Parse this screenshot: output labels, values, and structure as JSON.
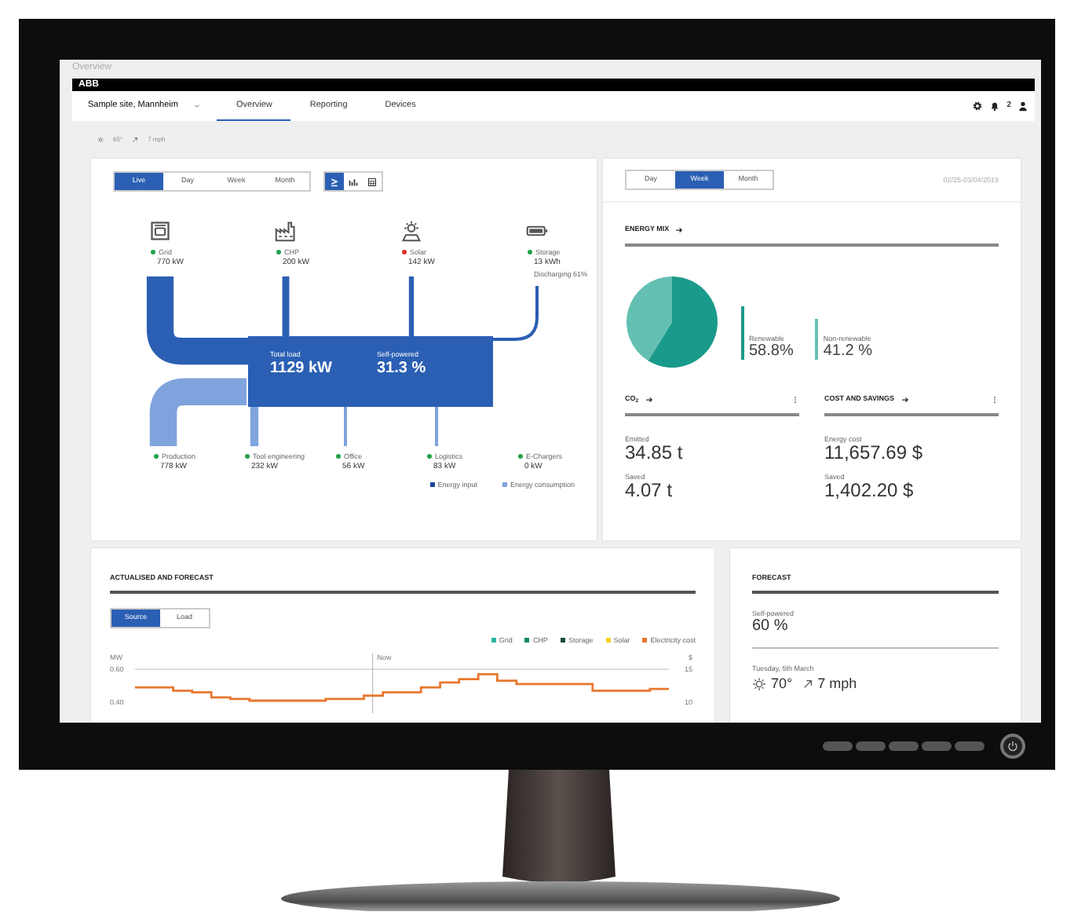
{
  "window": {
    "title": "Overview"
  },
  "brand": {
    "logo": "ABB"
  },
  "nav": {
    "site": "Sample site, Mannheim",
    "tabs": [
      {
        "label": "Overview",
        "selected": true
      },
      {
        "label": "Reporting",
        "selected": false
      },
      {
        "label": "Devices",
        "selected": false
      }
    ],
    "notifications": "2"
  },
  "weather": {
    "temperature": "65°",
    "wind": "7 mph"
  },
  "flow_card": {
    "periods": [
      {
        "label": "Live",
        "selected": true
      },
      {
        "label": "Day",
        "selected": false
      },
      {
        "label": "Week",
        "selected": false
      },
      {
        "label": "Month",
        "selected": false
      }
    ],
    "views": [
      {
        "kind": "flow",
        "selected": true
      },
      {
        "kind": "bars",
        "selected": false
      },
      {
        "kind": "table",
        "selected": false
      }
    ],
    "inputs": [
      {
        "kind": "grid",
        "name": "Grid",
        "value": "770 kW",
        "color": "#22a34a"
      },
      {
        "kind": "chp",
        "name": "CHP",
        "value": "200 kW",
        "color": "#22a34a"
      },
      {
        "kind": "solar",
        "name": "Solar",
        "value": "142 kW",
        "color": "#e0302a"
      },
      {
        "kind": "storage",
        "name": "Storage",
        "value": "13 kWh",
        "note": "Discharging 61%",
        "color": "#22a34a"
      }
    ],
    "total_load": {
      "label": "Total load",
      "value": "1129 kW"
    },
    "self_powered": {
      "label": "Self-powered",
      "value": "31.3 %"
    },
    "outputs": [
      {
        "name": "Production",
        "value": "778 kW",
        "color": "#22a34a"
      },
      {
        "name": "Tool engineering",
        "value": "232 kW",
        "color": "#22a34a"
      },
      {
        "name": "Office",
        "value": "56 kW",
        "color": "#22a34a"
      },
      {
        "name": "Logistics",
        "value": "83 kW",
        "color": "#22a34a"
      },
      {
        "name": "E-Chargers",
        "value": "0 kW",
        "color": "#22a34a"
      }
    ],
    "legend": [
      {
        "kind": "input",
        "label": "Energy input"
      },
      {
        "kind": "consumption",
        "label": "Energy consumption"
      }
    ]
  },
  "mix_card": {
    "periods": [
      {
        "label": "Day",
        "selected": false
      },
      {
        "label": "Week",
        "selected": true
      },
      {
        "label": "Month",
        "selected": false
      }
    ],
    "date_range": "02/25-03/04/2019",
    "energy_mix": {
      "title": "ENERGY MIX",
      "chart_data": {
        "type": "pie",
        "categories": [
          "Renewable",
          "Non-renewable"
        ],
        "values": [
          58.8,
          41.2
        ],
        "value_labels": [
          "58.8%",
          "41.2 %"
        ]
      }
    },
    "co2": {
      "title": "CO$_{2}$",
      "stats": [
        {
          "label": "Emitted",
          "value": "34.85 t"
        },
        {
          "label": "Saved",
          "value": "4.07 t"
        }
      ]
    },
    "cost": {
      "title": "COST AND SAVINGS",
      "stats": [
        {
          "label": "Energy cost",
          "value": "11,657.69 $"
        },
        {
          "label": "Saved",
          "value": "1,402.20 $"
        }
      ]
    }
  },
  "forecast_chart": {
    "title": "ACTUALISED AND FORECAST",
    "modes": [
      {
        "label": "Source",
        "selected": true
      },
      {
        "label": "Load",
        "selected": false
      }
    ],
    "right_axis": {
      "label": "$",
      "ticks": [
        "15",
        "10"
      ]
    },
    "chart_data": {
      "type": "line",
      "ylabel": "MW",
      "ylim": [
        0.4,
        0.6
      ],
      "yticks": [
        {
          "value": 0.6,
          "label": "0.60"
        },
        {
          "value": 0.4,
          "label": "0.40"
        }
      ],
      "annotations": [
        "Now"
      ],
      "series": [
        {
          "name": "Grid",
          "color": "#2bb5a0",
          "values": [
            null,
            null,
            null,
            null,
            null,
            null,
            null,
            null,
            null,
            null,
            null,
            null,
            null,
            null,
            null,
            null,
            null,
            null,
            null,
            null,
            null,
            null,
            null,
            null,
            null,
            null,
            null,
            null
          ]
        },
        {
          "name": "CHP",
          "color": "#0f8a6e",
          "values": [
            null,
            null,
            null,
            null,
            null,
            null,
            null,
            null,
            null,
            null,
            null,
            null,
            null,
            null,
            null,
            null,
            null,
            null,
            null,
            null,
            null,
            null,
            null,
            null,
            null,
            null,
            null,
            null
          ]
        },
        {
          "name": "Storage",
          "color": "#1d4a3a",
          "values": [
            null,
            null,
            null,
            null,
            null,
            null,
            null,
            null,
            null,
            null,
            null,
            null,
            null,
            null,
            null,
            null,
            null,
            null,
            null,
            null,
            null,
            null,
            null,
            null,
            null,
            null,
            null,
            null
          ]
        },
        {
          "name": "Solar",
          "color": "#f2d21a",
          "values": [
            null,
            null,
            null,
            null,
            null,
            null,
            null,
            null,
            null,
            null,
            null,
            null,
            null,
            null,
            null,
            null,
            null,
            null,
            null,
            null,
            null,
            null,
            null,
            null,
            null,
            null,
            null,
            null
          ]
        },
        {
          "name": "Electricity cost",
          "color": "#e8772e",
          "values": [
            0.49,
            0.49,
            0.47,
            0.46,
            0.43,
            0.42,
            0.41,
            0.41,
            0.41,
            0.41,
            0.42,
            0.42,
            0.44,
            0.46,
            0.46,
            0.49,
            0.52,
            0.54,
            0.57,
            0.53,
            0.51,
            0.51,
            0.51,
            0.51,
            0.47,
            0.47,
            0.47,
            0.48
          ]
        }
      ]
    }
  },
  "forecast": {
    "title": "FORECAST",
    "self_powered": {
      "label": "Self-powered",
      "value": "60 %"
    },
    "day": "Tuesday, 5th March",
    "temperature": "70°",
    "wind": "7 mph"
  }
}
